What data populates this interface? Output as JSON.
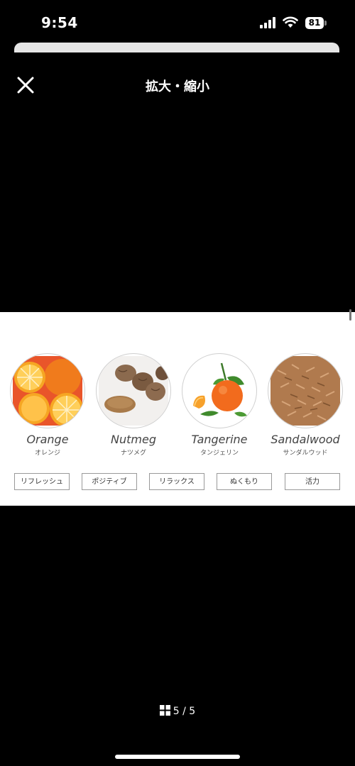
{
  "status_bar": {
    "time": "9:54",
    "battery": "81"
  },
  "header": {
    "title": "拡大・縮小"
  },
  "ingredients": [
    {
      "name": "Orange",
      "kana": "オレンジ",
      "icon": "orange-icon"
    },
    {
      "name": "Nutmeg",
      "kana": "ナツメグ",
      "icon": "nutmeg-icon"
    },
    {
      "name": "Tangerine",
      "kana": "タンジェリン",
      "icon": "tangerine-icon"
    },
    {
      "name": "Sandalwood",
      "kana": "サンダルウッド",
      "icon": "sandalwood-icon"
    }
  ],
  "tags": [
    "リフレッシュ",
    "ポジティブ",
    "リラックス",
    "ぬくもり",
    "活力"
  ],
  "pager": {
    "text": "5 / 5"
  }
}
